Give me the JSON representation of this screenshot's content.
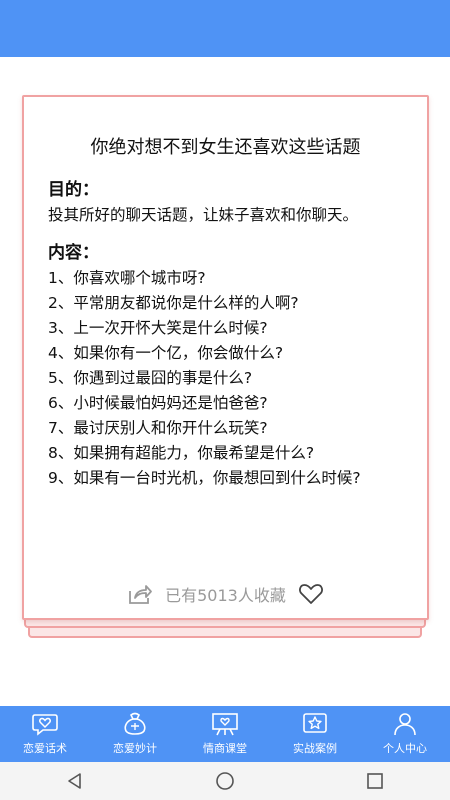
{
  "card": {
    "title": "你绝对想不到女生还喜欢这些话题",
    "purpose_heading": "目的：",
    "purpose_text": "投其所好的聊天话题，让妹子喜欢和你聊天。",
    "content_heading": "内容：",
    "items": [
      "1、你喜欢哪个城市呀?",
      "2、平常朋友都说你是什么样的人啊?",
      "3、上一次开怀大笑是什么时候?",
      "4、如果你有一个亿，你会做什么?",
      "5、你遇到过最囧的事是什么?",
      "6、小时候最怕妈妈还是怕爸爸?",
      "7、最讨厌别人和你开什么玩笑?",
      "8、如果拥有超能力，你最希望是什么?",
      "9、如果有一台时光机，你最想回到什么时候?"
    ],
    "favorites_text": "已有5013人收藏"
  },
  "bottom_nav": [
    {
      "label": "恋爱话术",
      "icon": "heart-bubble-icon"
    },
    {
      "label": "恋爱妙计",
      "icon": "bag-icon"
    },
    {
      "label": "情商课堂",
      "icon": "easel-icon"
    },
    {
      "label": "实战案例",
      "icon": "star-chat-icon"
    },
    {
      "label": "个人中心",
      "icon": "user-icon"
    }
  ],
  "colors": {
    "primary": "#4f93f5",
    "card_border": "#f0a2a2",
    "muted_text": "#9a9a9a"
  }
}
